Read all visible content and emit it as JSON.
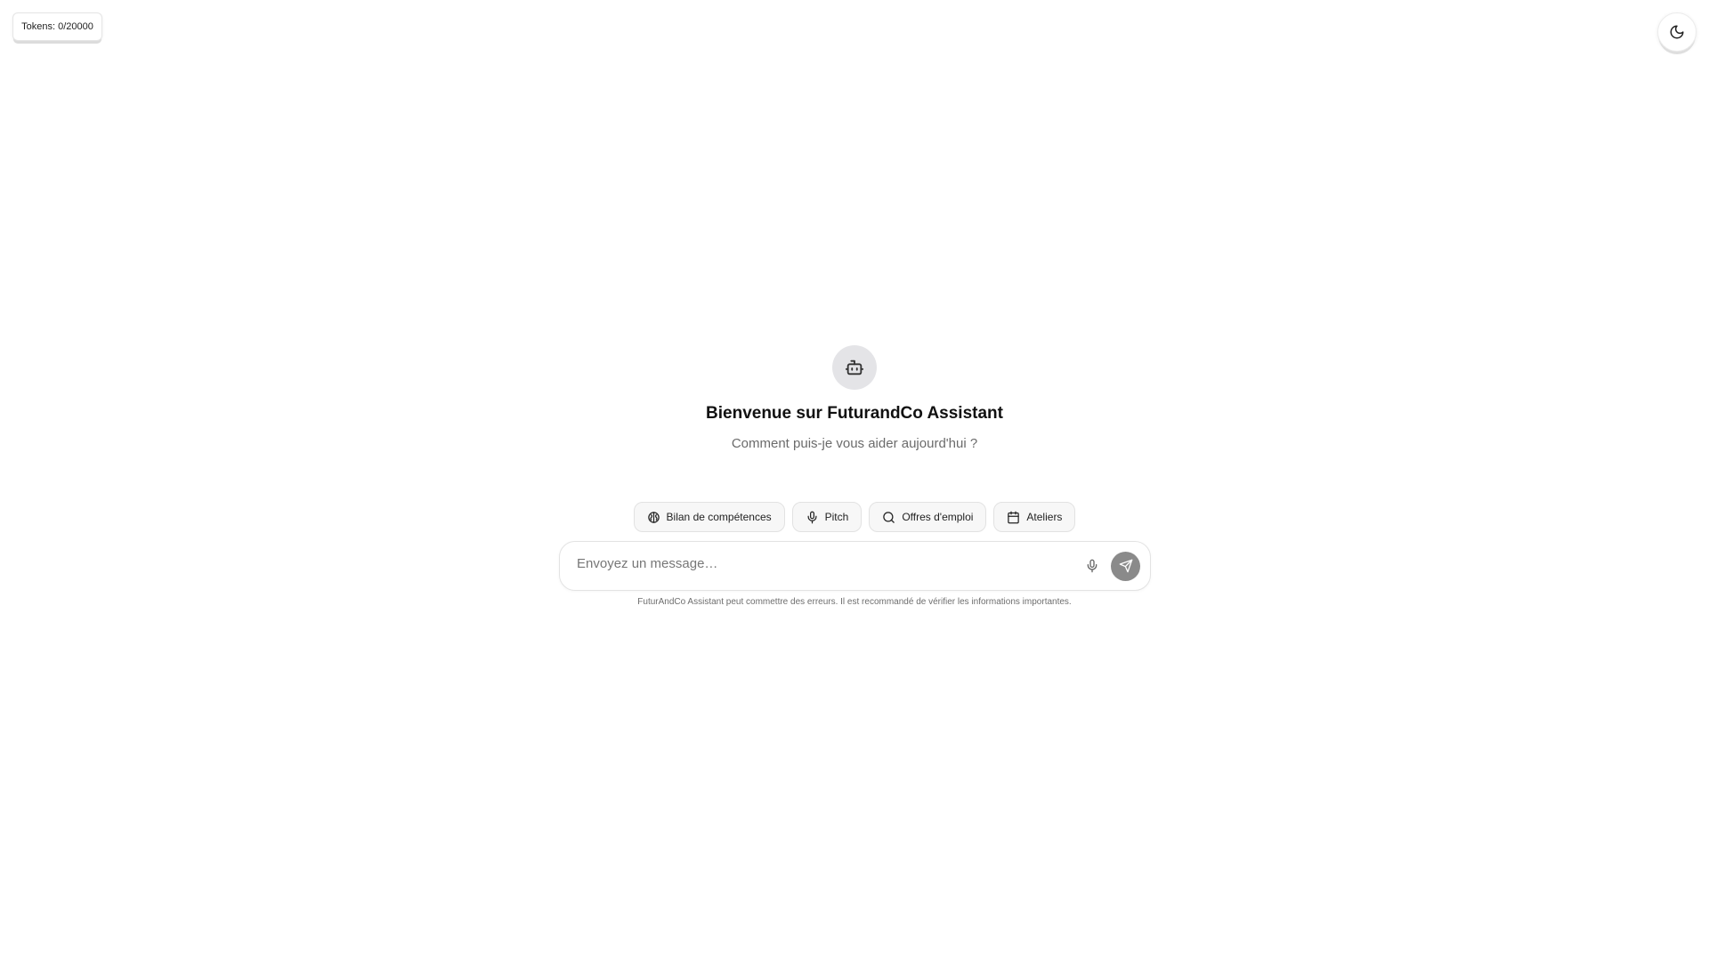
{
  "header": {
    "token_counter": "Tokens: 0/20000",
    "theme_toggle_icon": "moon-icon"
  },
  "welcome": {
    "avatar_icon": "bot-icon",
    "title": "Bienvenue sur FuturandCo Assistant",
    "subtitle": "Comment puis-je vous aider aujourd'hui ?"
  },
  "quick_actions": [
    {
      "label": "Bilan de compétences",
      "icon": "brain-icon"
    },
    {
      "label": "Pitch",
      "icon": "microphone-icon"
    },
    {
      "label": "Offres d'emploi",
      "icon": "search-icon"
    },
    {
      "label": "Ateliers",
      "icon": "calendar-icon"
    }
  ],
  "composer": {
    "placeholder": "Envoyez un message…",
    "value": "",
    "mic_icon": "microphone-icon",
    "send_icon": "send-icon"
  },
  "disclaimer": "FuturAndCo Assistant peut commettre des erreurs. Il est recommandé de vérifier les informations importantes.",
  "colors": {
    "send_button": "#8a8a8a",
    "avatar_bg": "#e4e4e7",
    "chip_bg": "#f7f7f7"
  }
}
